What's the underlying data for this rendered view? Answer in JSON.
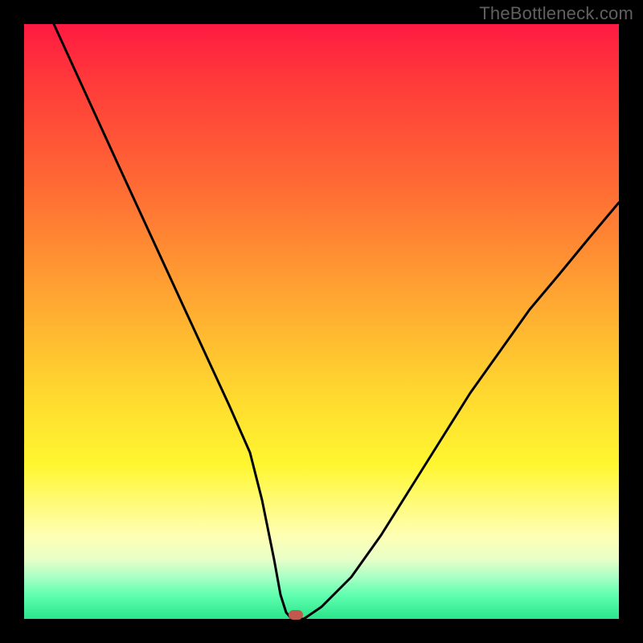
{
  "watermark": "TheBottleneck.com",
  "colors": {
    "frame": "#000000",
    "gradient_top": "#ff1a42",
    "gradient_mid": "#ffd82f",
    "gradient_bottom": "#29e58a",
    "curve": "#000000",
    "marker": "#c0594e"
  },
  "chart_data": {
    "type": "line",
    "title": "",
    "xlabel": "",
    "ylabel": "",
    "xlim": [
      0,
      100
    ],
    "ylim": [
      0,
      100
    ],
    "series": [
      {
        "name": "bottleneck-curve",
        "x": [
          5,
          10,
          15,
          20,
          25,
          30,
          35,
          38,
          40,
          42,
          44,
          45,
          47,
          50,
          55,
          60,
          65,
          70,
          75,
          80,
          85,
          90,
          95,
          100
        ],
        "values": [
          100,
          88,
          76,
          64,
          52,
          40,
          28,
          18,
          10,
          4,
          1,
          0,
          0,
          2,
          7,
          14,
          22,
          30,
          38,
          45,
          52,
          58,
          64,
          70
        ]
      }
    ],
    "marker": {
      "x": 45.5,
      "y": 0
    },
    "flat_region_x": [
      44,
      47
    ]
  }
}
